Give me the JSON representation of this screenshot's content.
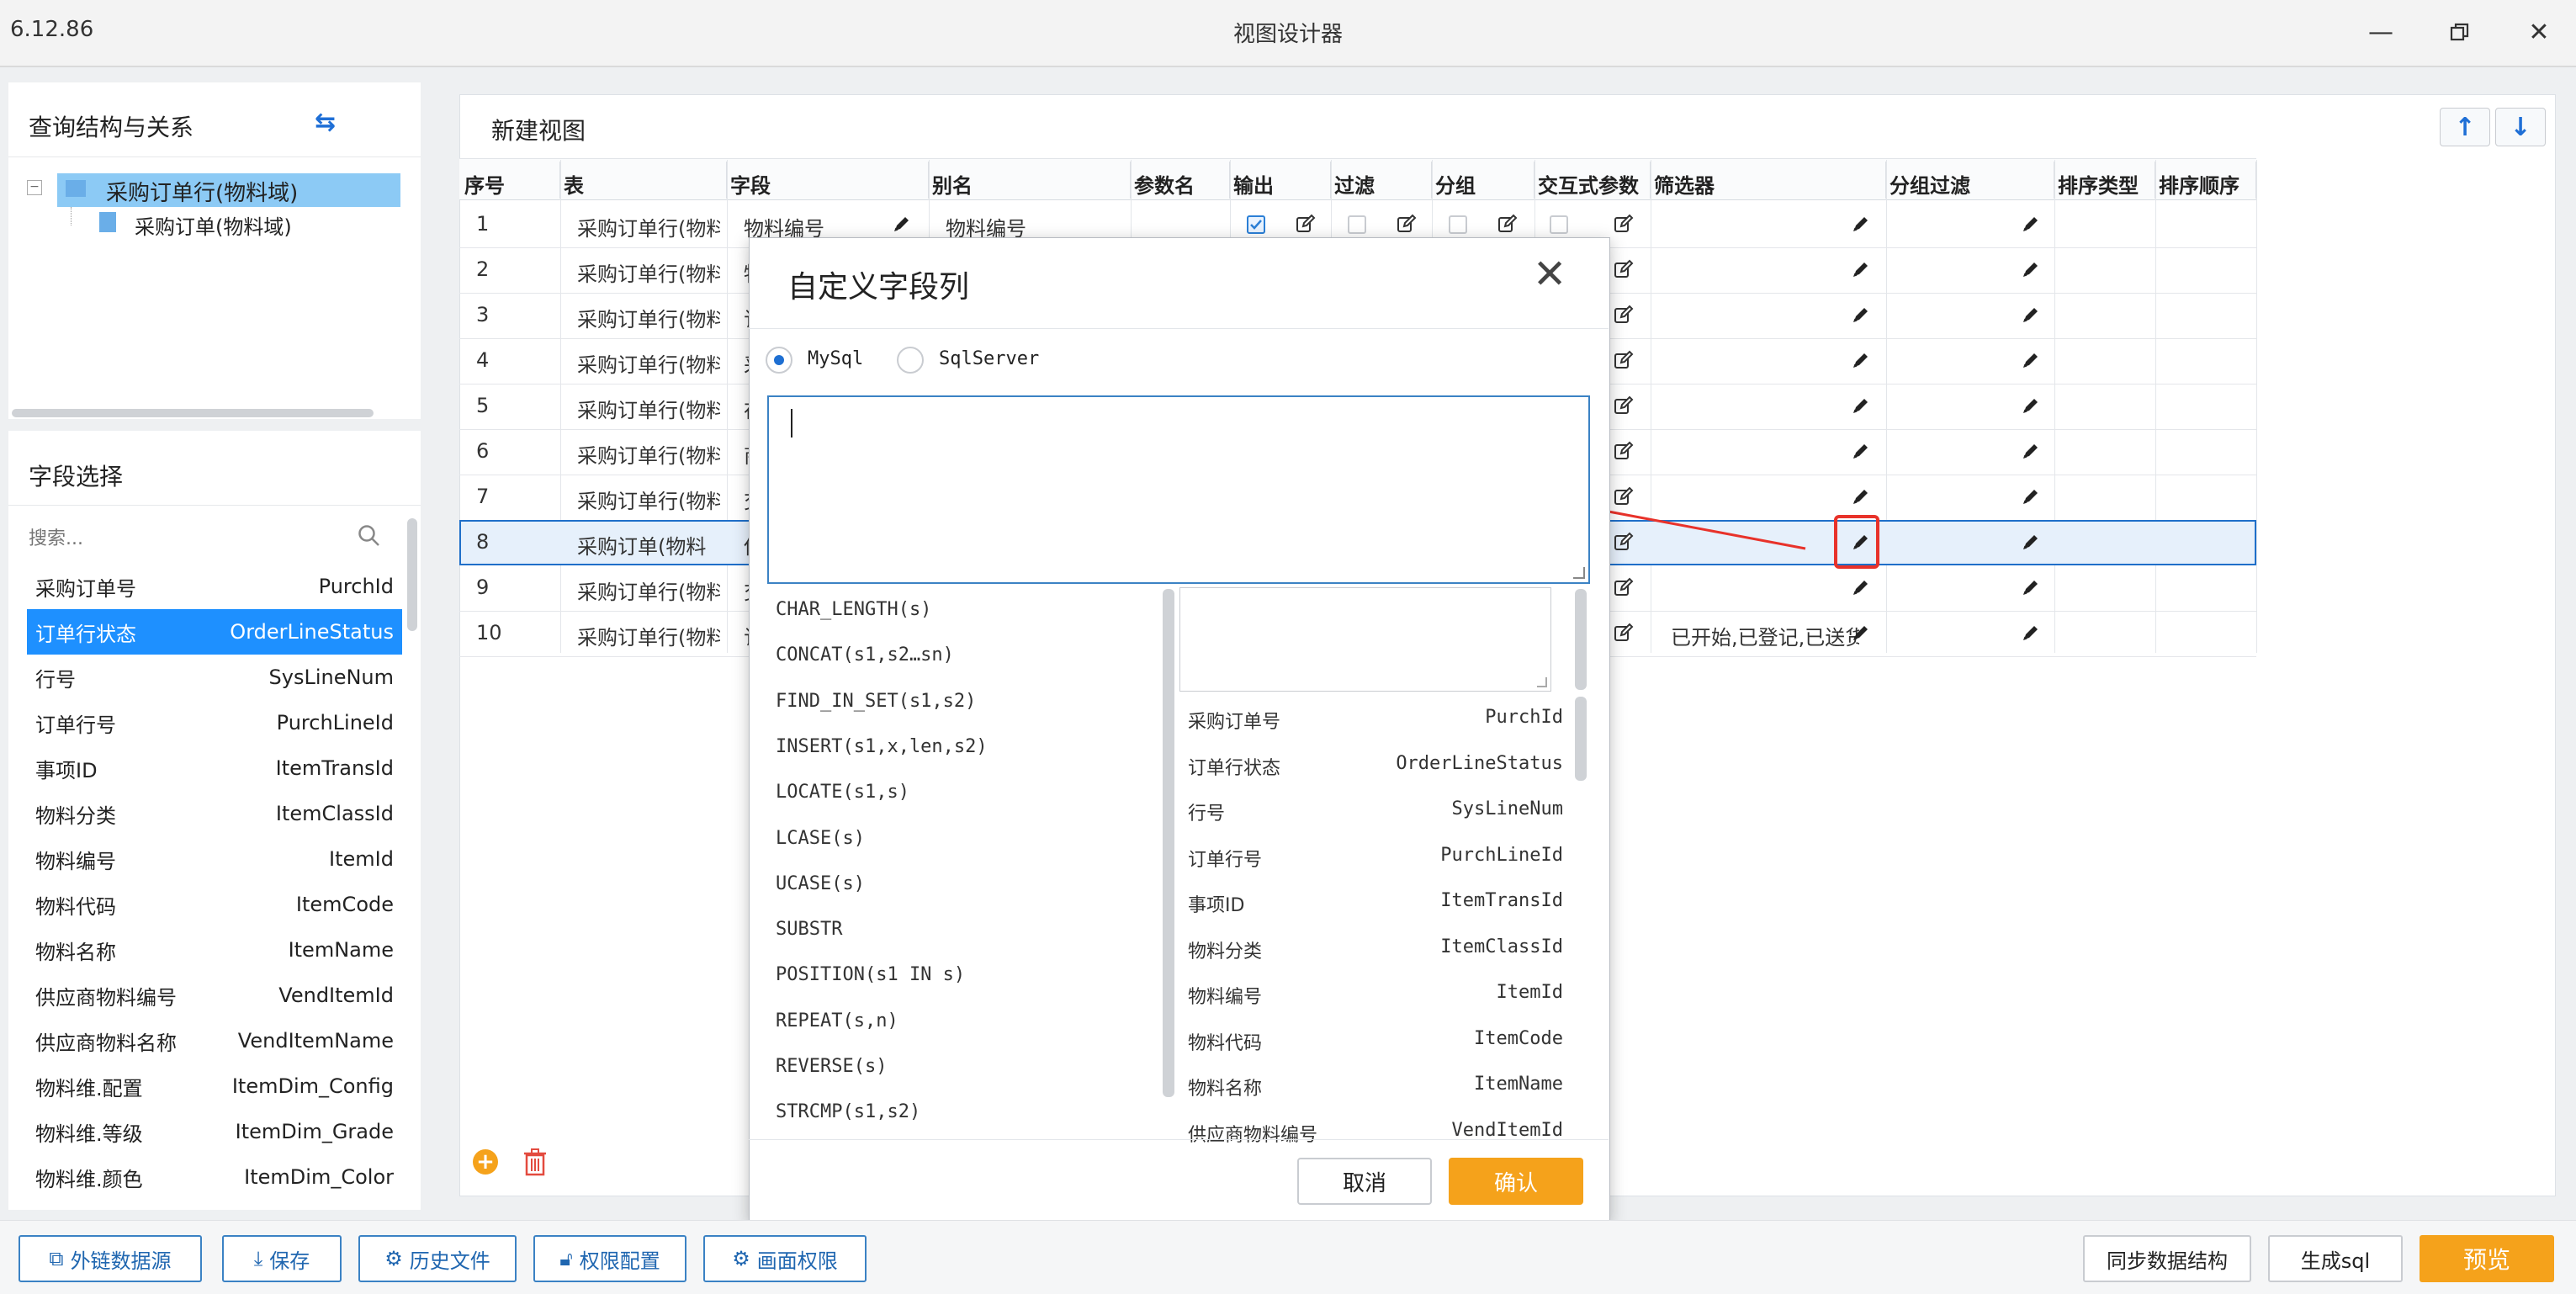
{
  "window": {
    "version": "6.12.86",
    "title": "视图设计器"
  },
  "left": {
    "query_title": "查询结构与关系",
    "tree": [
      "采购订单行(物料域)",
      "采购订单(物料域)"
    ],
    "field_title": "字段选择",
    "search_placeholder": "搜索...",
    "fields": [
      {
        "label": "采购订单号",
        "code": "PurchId"
      },
      {
        "label": "订单行状态",
        "code": "OrderLineStatus"
      },
      {
        "label": "行号",
        "code": "SysLineNum"
      },
      {
        "label": "订单行号",
        "code": "PurchLineId"
      },
      {
        "label": "事项ID",
        "code": "ItemTransId"
      },
      {
        "label": "物料分类",
        "code": "ItemClassId"
      },
      {
        "label": "物料编号",
        "code": "ItemId"
      },
      {
        "label": "物料代码",
        "code": "ItemCode"
      },
      {
        "label": "物料名称",
        "code": "ItemName"
      },
      {
        "label": "供应商物料编号",
        "code": "VendItemId"
      },
      {
        "label": "供应商物料名称",
        "code": "VendItemName"
      },
      {
        "label": "物料维.配置",
        "code": "ItemDim_Config"
      },
      {
        "label": "物料维.等级",
        "code": "ItemDim_Grade"
      },
      {
        "label": "物料维.颜色",
        "code": "ItemDim_Color"
      }
    ]
  },
  "main": {
    "title": "新建视图",
    "columns": [
      "序号",
      "表",
      "字段",
      "别名",
      "参数名",
      "输出",
      "过滤",
      "分组",
      "交互式参数",
      "筛选器",
      "分组过滤",
      "排序类型",
      "排序顺序"
    ],
    "rows": [
      {
        "no": "1",
        "table": "采购订单行(物料",
        "field": "物料编号",
        "alias": "物料编号",
        "filter": ""
      },
      {
        "no": "2",
        "table": "采购订单行(物料",
        "field": "物",
        "alias": "",
        "filter": ""
      },
      {
        "no": "3",
        "table": "采购订单行(物料",
        "field": "订",
        "alias": "",
        "filter": ""
      },
      {
        "no": "4",
        "table": "采购订单行(物料",
        "field": "采",
        "alias": "",
        "filter": ""
      },
      {
        "no": "5",
        "table": "采购订单行(物料",
        "field": "在",
        "alias": "",
        "filter": ""
      },
      {
        "no": "6",
        "table": "采购订单行(物料",
        "field": "商",
        "alias": "",
        "filter": ""
      },
      {
        "no": "7",
        "table": "采购订单行(物料",
        "field": "交",
        "alias": "",
        "filter": ""
      },
      {
        "no": "8",
        "table": "采购订单(物料",
        "field": "供",
        "alias": "",
        "filter": ""
      },
      {
        "no": "9",
        "table": "采购订单行(物料",
        "field": "交",
        "alias": "",
        "filter": ""
      },
      {
        "no": "10",
        "table": "采购订单行(物料",
        "field": "订",
        "alias": "",
        "filter": "已开始,已登记,已送货"
      }
    ]
  },
  "dialog": {
    "title": "自定义字段列",
    "radio_mysql": "MySql",
    "radio_sqlserver": "SqlServer",
    "functions": [
      "CHAR_LENGTH(s)",
      "CONCAT(s1,s2…sn)",
      "FIND_IN_SET(s1,s2)",
      "INSERT(s1,x,len,s2)",
      "LOCATE(s1,s)",
      "LCASE(s)",
      "UCASE(s)",
      "SUBSTR",
      "POSITION(s1 IN s)",
      "REPEAT(s,n)",
      "REVERSE(s)",
      "STRCMP(s1,s2)"
    ],
    "fields": [
      {
        "label": "采购订单号",
        "code": "PurchId"
      },
      {
        "label": "订单行状态",
        "code": "OrderLineStatus"
      },
      {
        "label": "行号",
        "code": "SysLineNum"
      },
      {
        "label": "订单行号",
        "code": "PurchLineId"
      },
      {
        "label": "事项ID",
        "code": "ItemTransId"
      },
      {
        "label": "物料分类",
        "code": "ItemClassId"
      },
      {
        "label": "物料编号",
        "code": "ItemId"
      },
      {
        "label": "物料代码",
        "code": "ItemCode"
      },
      {
        "label": "物料名称",
        "code": "ItemName"
      },
      {
        "label": "供应商物料编号",
        "code": "VendItemId"
      }
    ],
    "cancel": "取消",
    "confirm": "确认"
  },
  "toolbar": {
    "external": "外链数据源",
    "save": "保存",
    "history": "历史文件",
    "permission": "权限配置",
    "screen_permission": "画面权限",
    "sync": "同步数据结构",
    "gen_sql": "生成sql",
    "preview": "预览"
  },
  "colors": {
    "accent": "#1e90ff",
    "confirm": "#f5a21b",
    "annotation": "#e8322a"
  }
}
